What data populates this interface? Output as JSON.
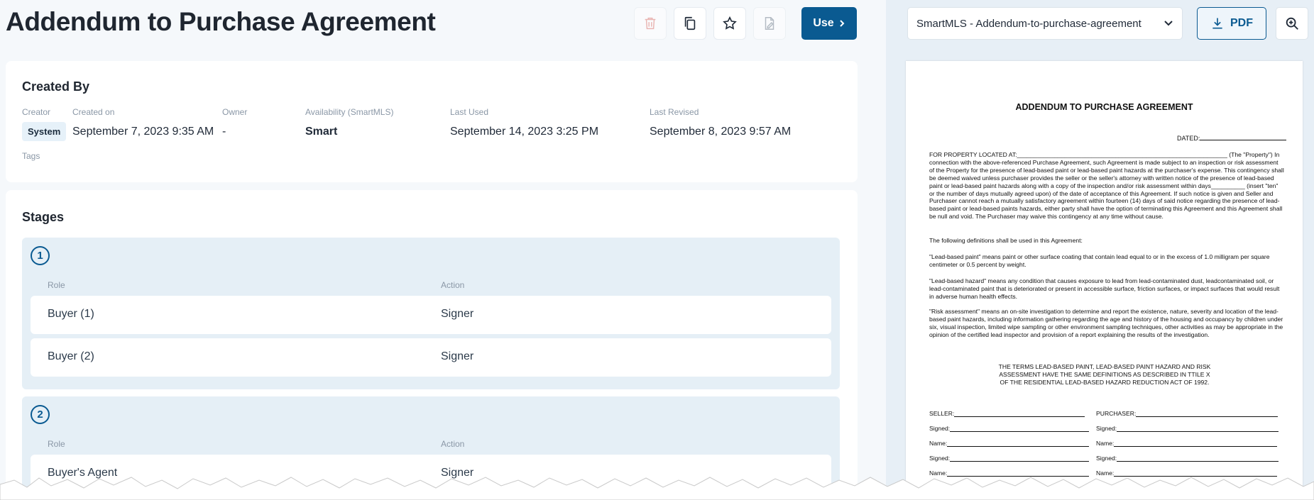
{
  "page": {
    "title": "Addendum to Purchase Agreement",
    "use_label": "Use"
  },
  "toolbar_icons": [
    "trash-icon",
    "copy-icon",
    "star-icon",
    "document-edit-icon",
    "chevron-right-icon"
  ],
  "created_by": {
    "heading": "Created By",
    "creator_label": "Creator",
    "creator_value": "System",
    "created_on_label": "Created on",
    "created_on_value": "September 7, 2023 9:35 AM",
    "owner_label": "Owner",
    "owner_value": "-",
    "availability_label": "Availability (SmartMLS)",
    "availability_value": "Smart",
    "last_used_label": "Last Used",
    "last_used_value": "September 14, 2023 3:25 PM",
    "last_revised_label": "Last Revised",
    "last_revised_value": "September 8, 2023 9:57 AM",
    "tags_label": "Tags"
  },
  "stages": {
    "heading": "Stages",
    "role_label": "Role",
    "action_label": "Action",
    "items": [
      {
        "number": "1",
        "rows": [
          {
            "role": "Buyer (1)",
            "action": "Signer"
          },
          {
            "role": "Buyer (2)",
            "action": "Signer"
          }
        ]
      },
      {
        "number": "2",
        "rows": [
          {
            "role": "Buyer's Agent",
            "action": "Signer"
          }
        ]
      }
    ]
  },
  "preview": {
    "select_value": "SmartMLS - Addendum-to-purchase-agreement",
    "pdf_label": "PDF",
    "icons": [
      "chevron-down-icon",
      "download-icon",
      "zoom-in-icon"
    ],
    "doc": {
      "heading": "ADDENDUM TO PURCHASE AGREEMENT",
      "dated": "DATED:",
      "para1": "FOR PROPERTY LOCATED AT:______________________________________________________________ (The \"Property\") In connection with the above-referenced Purchase Agreement, such Agreement is made subject to an inspection or risk assessment of the Property for the presence of lead-based paint or lead-based paint hazards at the purchaser's expense. This contingency shall be deemed waived unless purchaser provides the seller or the seller's attorney with written notice of the presence of lead-based paint or lead-based paint hazards along with a copy of the inspection and/or risk assessment within days__________ (insert \"ten\" or the number of days mutually agreed upon) of the date of acceptance of this Agreement. If such notice is given and Seller and Purchaser cannot reach a mutually satisfactory agreement within fourteen (14) days of said notice regarding the presence of lead-based paint or lead-based paints hazards, either party shall have the option of terminating this Agreement and this Agreement shall be null and void. The Purchaser may waive this contingency at any time without cause.",
      "para2": "The following definitions shall be used in this Agreement:",
      "para3": "\"Lead-based paint\" means paint or other surface coating that contain lead equal to or in the excess of 1.0 milligram per square centimeter or 0.5 percent by weight.",
      "para4": "\"Lead-based hazard\" means any condition that causes exposure to lead from lead-contaminated dust, leadcontaminated soil, or lead-contaminated paint that is deteriorated or present in accessible surface, friction surfaces, or impact surfaces that would result in adverse human health effects.",
      "para5": "\"Risk assessment\" means an on-site investigation to determine and report the existence, nature, severity and location of the lead-based paint hazards, including information gathering regarding the age and history of the housing and occupancy by children under six, visual inspection, limited wipe sampling or other environment sampling techniques, other activities as may be appropriate in the opinion of the certified lead inspector and provision of a report explaining the results of the investigation.",
      "center_line1": "THE TERMS LEAD-BASED PAINT, LEAD-BASED PAINT HAZARD AND RISK",
      "center_line2": "ASSESSMENT HAVE THE SAME DEFINITIONS AS DESCRIBED IN TTILE X",
      "center_line3": "OF THE RESIDENTIAL LEAD-BASED HAZARD REDUCTION ACT OF 1992.",
      "seller_label": "SELLER:",
      "purchaser_label": "PURCHASER:",
      "signed_label": "Signed:",
      "name_label": "Name:"
    }
  }
}
